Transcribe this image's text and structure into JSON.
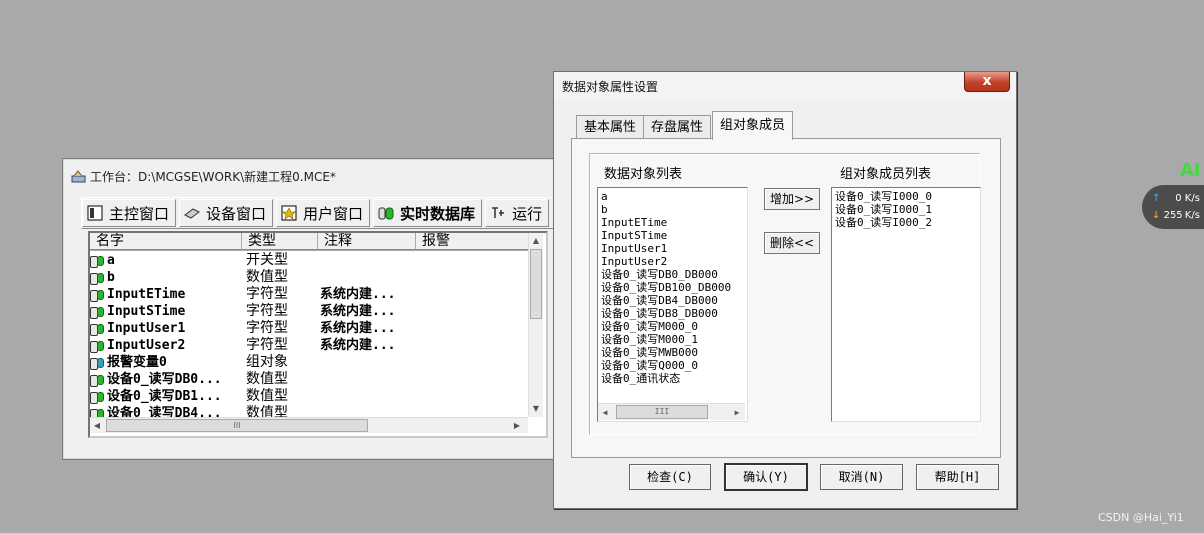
{
  "workbench": {
    "title": "工作台：D:\\MCGSE\\WORK\\新建工程0.MCE*",
    "tabs": [
      {
        "label": "主控窗口",
        "icon": "main-window-icon"
      },
      {
        "label": "设备窗口",
        "icon": "device-icon"
      },
      {
        "label": "用户窗口",
        "icon": "user-window-icon"
      },
      {
        "label": "实时数据库",
        "icon": "database-icon"
      },
      {
        "label": "运行",
        "icon": "run-strategy-icon"
      }
    ],
    "active_tab": "实时数据库",
    "columns": [
      "名字",
      "类型",
      "注释",
      "报警"
    ],
    "rows": [
      {
        "name": "a",
        "type": "开关型",
        "note": ""
      },
      {
        "name": "b",
        "type": "数值型",
        "note": ""
      },
      {
        "name": "InputETime",
        "type": "字符型",
        "note": "系统内建..."
      },
      {
        "name": "InputSTime",
        "type": "字符型",
        "note": "系统内建..."
      },
      {
        "name": "InputUser1",
        "type": "字符型",
        "note": "系统内建..."
      },
      {
        "name": "InputUser2",
        "type": "字符型",
        "note": "系统内建..."
      },
      {
        "name": "报警变量0",
        "type": "组对象",
        "note": ""
      },
      {
        "name": "设备0_读写DB0...",
        "type": "数值型",
        "note": ""
      },
      {
        "name": "设备0_读写DB1...",
        "type": "数值型",
        "note": ""
      },
      {
        "name": "设备0_读写DB4...",
        "type": "数值型",
        "note": ""
      }
    ],
    "hscroll_grip": "III"
  },
  "dialog": {
    "title": "数据对象属性设置",
    "close_label": "x",
    "tabs": [
      "基本属性",
      "存盘属性",
      "组对象成员"
    ],
    "active_tab": "组对象成员",
    "left_label": "数据对象列表",
    "right_label": "组对象成员列表",
    "object_list": [
      "a",
      "b",
      "InputETime",
      "InputSTime",
      "InputUser1",
      "InputUser2",
      "设备0_读写DB0_DB000",
      "设备0_读写DB100_DB000",
      "设备0_读写DB4_DB000",
      "设备0_读写DB8_DB000",
      "设备0_读写M000_0",
      "设备0_读写M000_1",
      "设备0_读写MWB000",
      "设备0_读写Q000_0",
      "设备0_通讯状态"
    ],
    "member_list": [
      "设备0_读写I000_0",
      "设备0_读写I000_1",
      "设备0_读写I000_2"
    ],
    "add_label": "增加>>",
    "remove_label": "删除<<",
    "buttons": {
      "check": "检查(C)",
      "ok": "确认(Y)",
      "cancel": "取消(N)",
      "help": "帮助[H]"
    }
  },
  "net_widget": {
    "up_speed": "0",
    "down_speed": "255",
    "unit": "K/s",
    "up_arrow": "↑",
    "down_arrow": "↓"
  },
  "overlay_text": "AI",
  "watermark": "CSDN @Hai_Yi1"
}
